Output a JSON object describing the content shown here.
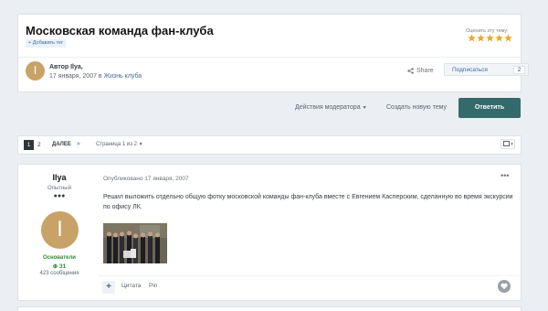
{
  "topic": {
    "title": "Московская команда фан-клуба",
    "add_tag_label": "+ Добавить тег",
    "rate_label": "Оценить эту тему:",
    "rating": 5,
    "author_line": "Автор Ilya,",
    "date_prefix": "17 января, 2007 в ",
    "forum_name": "Жизнь клуба",
    "share_label": "Share",
    "subscribe_label": "Подписаться",
    "subscribe_count": "2",
    "avatar_letter": "I"
  },
  "actions": {
    "moderator_label": "Действия модератора",
    "new_topic_label": "Создать новую тему",
    "reply_label": "Ответить"
  },
  "pagination": {
    "current_page": "1",
    "page_2": "2",
    "next_label": "ДАЛЕЕ",
    "last_glyph": "»",
    "page_of": "Страница 1 из 2"
  },
  "post": {
    "username": "Ilya",
    "rank": "Опытный",
    "avatar_letter": "I",
    "group": "Основатели",
    "reputation": "31",
    "posts_count": "423 сообщения",
    "meta": "Опубликовано 17 января, 2007",
    "text": "Решил выложить отдельно общую фотку московской команды фан-клуба вместе с Евгением Касперским, сделанную во время экскурсии по офису ЛК.",
    "quote_label": "Цитата",
    "pin_label": "Pin"
  },
  "colors": {
    "reply_button": "#346a6b",
    "star": "#e8a82a",
    "group": "#2f8a3a",
    "link": "#3e6d9f"
  }
}
